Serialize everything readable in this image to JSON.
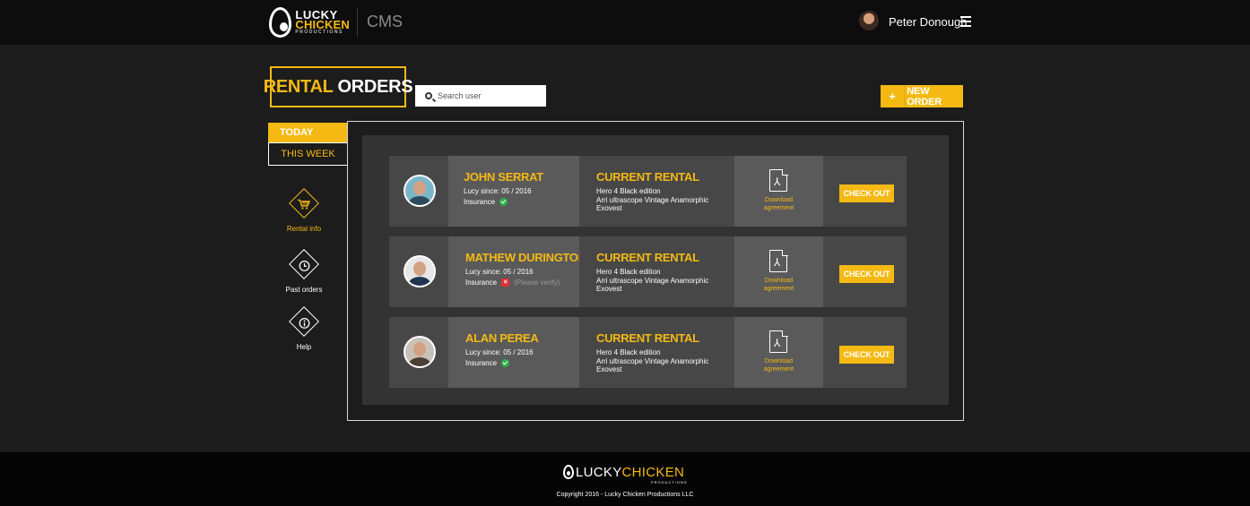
{
  "brand": {
    "logo_line1": "LUCKY",
    "logo_line2": "CHICKEN",
    "logo_line3": "PRODUCTIONS",
    "app_name": "CMS",
    "accent_color": "#f5b913"
  },
  "user": {
    "name": "Peter Donough",
    "menu_icon": "hamburger-icon"
  },
  "header": {
    "title_part1": "RENTAL",
    "title_part2": "ORDERS",
    "search_placeholder": "Search user",
    "new_order_icon": "+",
    "new_order_label": "NEW ORDER"
  },
  "tabs": {
    "today": "TODAY",
    "this_week": "THIS WEEK",
    "active": "today"
  },
  "nav": [
    {
      "label": "Rental info",
      "icon": "cart-icon",
      "active": true
    },
    {
      "label": "Past orders",
      "icon": "clock-icon",
      "active": false
    },
    {
      "label": "Help",
      "icon": "info-icon",
      "active": false
    }
  ],
  "orders": [
    {
      "name": "JOHN SERRAT",
      "since": "Lucy since: 05 / 2016",
      "insurance_label": "Insurance",
      "insurance_ok": true,
      "insurance_note": "",
      "rental_title": "CURRENT RENTAL",
      "rental_items": [
        "Hero 4 Black edition",
        "Arri ultrascope Vintage Anamorphic",
        "Exovest"
      ],
      "download_line1": "Download",
      "download_line2": "agreement",
      "action": "CHECK OUT"
    },
    {
      "name": "MATHEW DURINGTON",
      "since": "Lucy since: 05 / 2016",
      "insurance_label": "Insurance",
      "insurance_ok": false,
      "insurance_note": "(Please verify)",
      "rental_title": "CURRENT RENTAL",
      "rental_items": [
        "Hero 4 Black edition",
        "Arri ultrascope Vintage Anamorphic",
        "Exovest"
      ],
      "download_line1": "Download",
      "download_line2": "agreement",
      "action": "CHECK OUT"
    },
    {
      "name": "ALAN PEREA",
      "since": "Lucy since: 05 / 2016",
      "insurance_label": "Insurance",
      "insurance_ok": true,
      "insurance_note": "",
      "rental_title": "CURRENT RENTAL",
      "rental_items": [
        "Hero 4 Black edition",
        "Arri ultrascope Vintage Anamorphic",
        "Exovest"
      ],
      "download_line1": "Download",
      "download_line2": "agreement",
      "action": "CHECK OUT"
    }
  ],
  "footer": {
    "logo_a": "LUCKY",
    "logo_b": "CHICKEN",
    "logo_sub": "PRODUCTIONS",
    "copyright": "Copyright 2016 - Lucky Chicken Productions LLC"
  }
}
